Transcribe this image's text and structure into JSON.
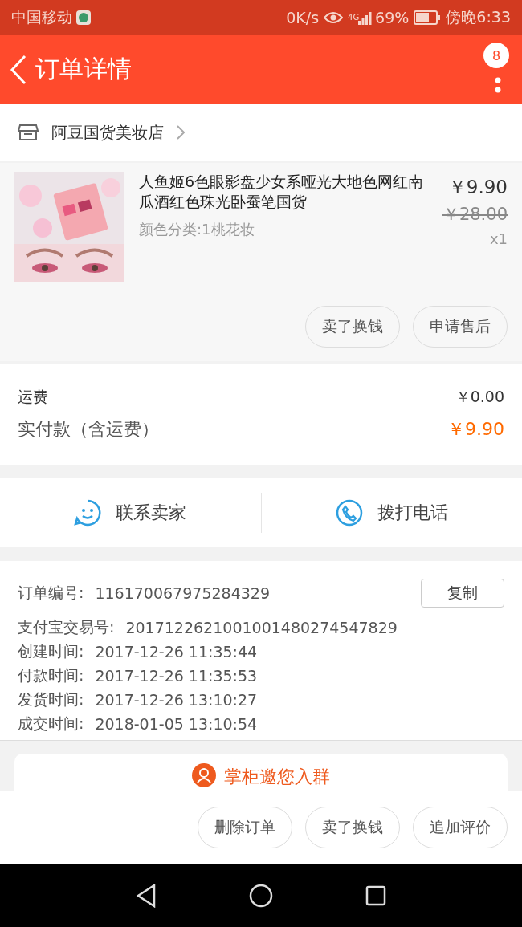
{
  "status_bar": {
    "carrier": "中国移动",
    "speed": "0K/s",
    "network": "4G",
    "battery_text": "69%",
    "time": "傍晚6:33"
  },
  "header": {
    "title": "订单详情",
    "badge": "8"
  },
  "shop": {
    "name": "阿豆国货美妆店"
  },
  "product": {
    "kind": "picture",
    "title": "人鱼姬6色眼影盘少女系哑光大地色网红南瓜酒红色珠光卧蚕笔国货",
    "variant": "颜色分类:1桃花妆",
    "price": "￥9.90",
    "original_price": "￥28.00",
    "quantity": "x1",
    "actions": [
      "卖了换钱",
      "申请售后"
    ]
  },
  "fees": [
    {
      "label": "运费",
      "value": "￥0.00",
      "kind": "plain"
    },
    {
      "label": "实付款（含运费）",
      "value": "￥9.90",
      "kind": "total"
    }
  ],
  "contact": [
    {
      "label": "联系卖家",
      "kind": "chat"
    },
    {
      "label": "拨打电话",
      "kind": "phone"
    }
  ],
  "info": [
    {
      "label": "订单编号:",
      "value": "116170067975284329",
      "copy": "复制"
    },
    {
      "label": "支付宝交易号:",
      "value": "2017122621001001480274547829"
    },
    {
      "label": "创建时间:",
      "value": "2017-12-26 11:35:44"
    },
    {
      "label": "付款时间:",
      "value": "2017-12-26 11:35:53"
    },
    {
      "label": "发货时间:",
      "value": "2017-12-26 13:10:27"
    },
    {
      "label": "成交时间:",
      "value": "2018-01-05 13:10:54"
    }
  ],
  "group_invite": "掌柜邀您入群",
  "bottom_actions": [
    "删除订单",
    "卖了换钱",
    "追加评价"
  ]
}
